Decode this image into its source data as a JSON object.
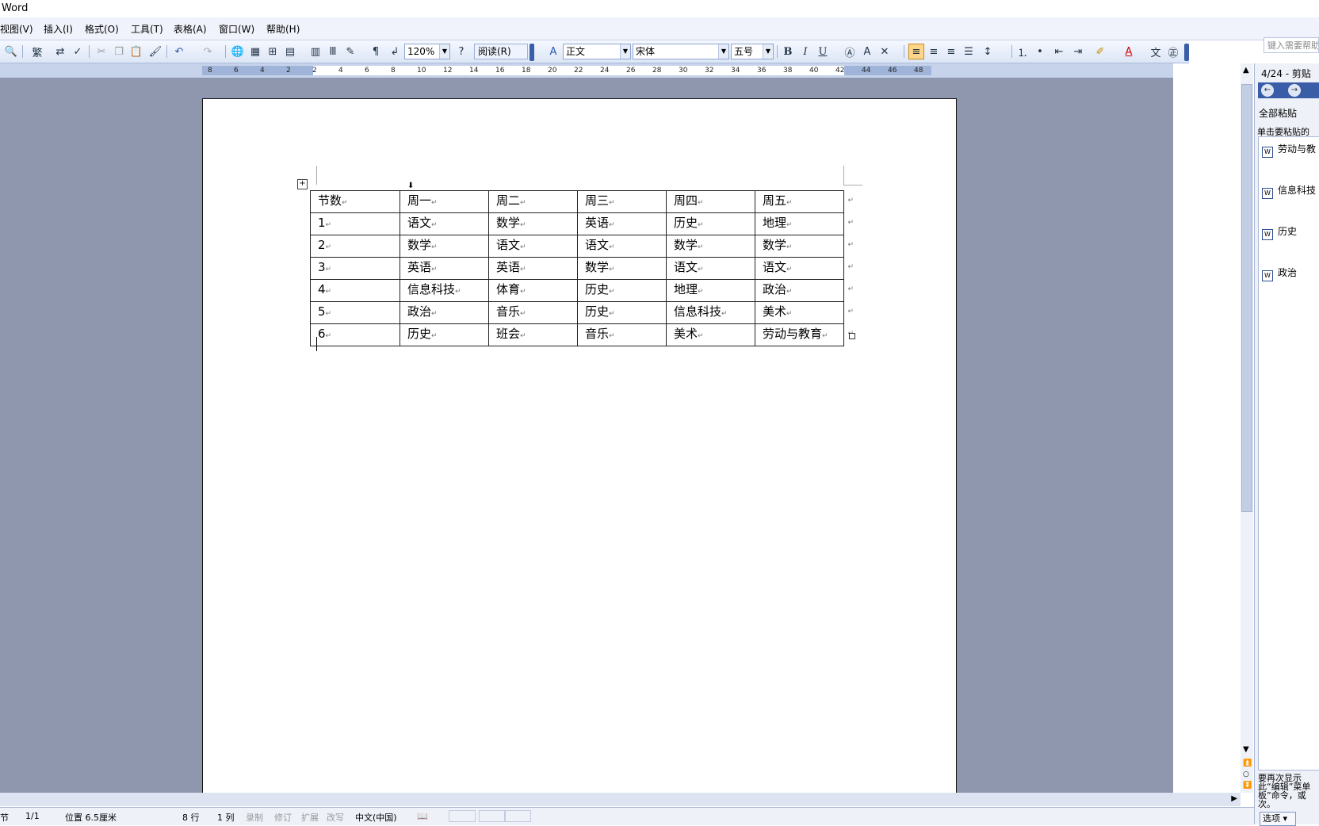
{
  "window": {
    "title": "Word"
  },
  "menu": {
    "items": [
      "视图(V)",
      "插入(I)",
      "格式(O)",
      "工具(T)",
      "表格(A)",
      "窗口(W)",
      "帮助(H)"
    ],
    "help_placeholder": "键入需要帮助"
  },
  "toolbar": {
    "traditional_label": "繁",
    "zoom": "120%",
    "read_label": "阅读(R)",
    "style": "正文",
    "font": "宋体",
    "size": "五号",
    "bold": "B",
    "italic": "I",
    "underline": "U"
  },
  "ruler": {
    "labels": [
      "8",
      "6",
      "4",
      "2",
      "2",
      "4",
      "6",
      "8",
      "10",
      "12",
      "14",
      "16",
      "18",
      "20",
      "22",
      "24",
      "26",
      "28",
      "30",
      "32",
      "34",
      "36",
      "38",
      "40",
      "42",
      "44",
      "46",
      "48"
    ]
  },
  "table": {
    "rows": [
      [
        "节数",
        "周一",
        "周二",
        "周三",
        "周四",
        "周五"
      ],
      [
        "1",
        "语文",
        "数学",
        "英语",
        "历史",
        "地理"
      ],
      [
        "2",
        "数学",
        "语文",
        "语文",
        "数学",
        "数学"
      ],
      [
        "3",
        "英语",
        "英语",
        "数学",
        "语文",
        "语文"
      ],
      [
        "4",
        "信息科技",
        "体育",
        "历史",
        "地理",
        "政治"
      ],
      [
        "5",
        "政治",
        "音乐",
        "历史",
        "信息科技",
        "美术"
      ],
      [
        "6",
        "历史",
        "班会",
        "音乐",
        "美术",
        "劳动与教育"
      ]
    ]
  },
  "taskpane": {
    "title": "4/24 - 剪贴",
    "paste_all": "全部粘贴",
    "hint": "单击要粘贴的",
    "items": [
      "劳动与教",
      "信息科技",
      "历史",
      "政治"
    ],
    "footer": "要再次显示此“编辑”菜单板”命令，或次。",
    "options": "选项 ▾"
  },
  "status": {
    "section": "节",
    "page": "1/1",
    "position": "位置 6.5厘米",
    "line": "8 行",
    "col": "1 列",
    "rec": "录制",
    "trk": "修订",
    "ext": "扩展",
    "ovr": "改写",
    "lang": "中文(中国)"
  }
}
